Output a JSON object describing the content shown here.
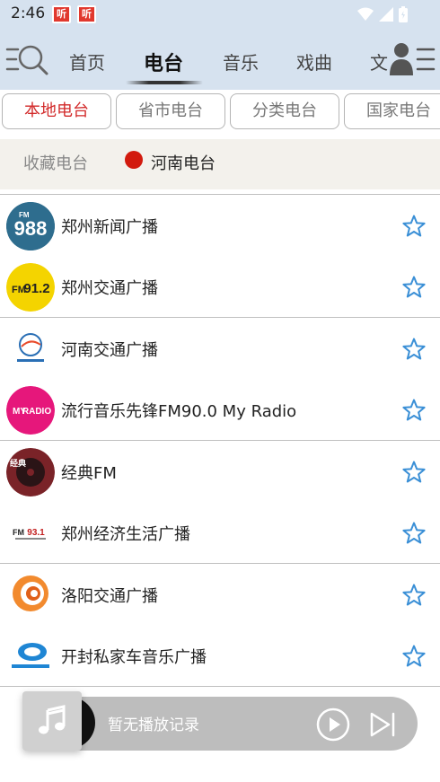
{
  "status_bar": {
    "time": "2:46",
    "notif_icons": [
      "听",
      "听"
    ]
  },
  "top_nav": {
    "tabs": [
      {
        "label": "首页",
        "active": false
      },
      {
        "label": "电台",
        "active": true
      },
      {
        "label": "音乐",
        "active": false
      },
      {
        "label": "戏曲",
        "active": false
      },
      {
        "label": "文",
        "active": false
      }
    ]
  },
  "sub_tabs": [
    {
      "label": "本地电台",
      "active": true
    },
    {
      "label": "省市电台",
      "active": false
    },
    {
      "label": "分类电台",
      "active": false
    },
    {
      "label": "国家电台",
      "active": false
    }
  ],
  "filter": {
    "favorites": "收藏电台",
    "region": "河南电台"
  },
  "stations": [
    {
      "name": "郑州新闻广播",
      "logo_text": "988",
      "logo_sub": "FM",
      "logo_bg": "#2e6d8e",
      "logo_fg": "#ffffff",
      "favorited": false
    },
    {
      "name": "郑州交通广播",
      "logo_text": "91.2",
      "logo_sub": "FM",
      "logo_bg": "#f4d400",
      "logo_fg": "#222222",
      "favorited": false
    },
    {
      "name": "河南交通广播",
      "logo_text": "",
      "logo_sub": "",
      "logo_bg": "#ffffff",
      "logo_fg": "#2a6fb5",
      "favorited": false
    },
    {
      "name": "流行音乐先锋FM90.0 My Radio",
      "logo_text": "RADIO",
      "logo_sub": "MY",
      "logo_bg": "#e6177b",
      "logo_fg": "#ffffff",
      "favorited": false
    },
    {
      "name": "经典FM",
      "logo_text": "经典",
      "logo_sub": "",
      "logo_bg": "#7a2328",
      "logo_fg": "#ffffff",
      "favorited": false
    },
    {
      "name": "郑州经济生活广播",
      "logo_text": "93.1",
      "logo_sub": "FM",
      "logo_bg": "#ffffff",
      "logo_fg": "#c21f1f",
      "favorited": false
    },
    {
      "name": "洛阳交通广播",
      "logo_text": "",
      "logo_sub": "",
      "logo_bg": "#ffffff",
      "logo_fg": "#e0601a",
      "favorited": false
    },
    {
      "name": "开封私家车音乐广播",
      "logo_text": "",
      "logo_sub": "",
      "logo_bg": "#ffffff",
      "logo_fg": "#1f86d4",
      "favorited": false
    }
  ],
  "player": {
    "status_text": "暂无播放记录"
  },
  "colors": {
    "nav_bg": "#d6e2ef",
    "accent_red": "#d22a2a",
    "star_blue": "#3a8fd6"
  }
}
